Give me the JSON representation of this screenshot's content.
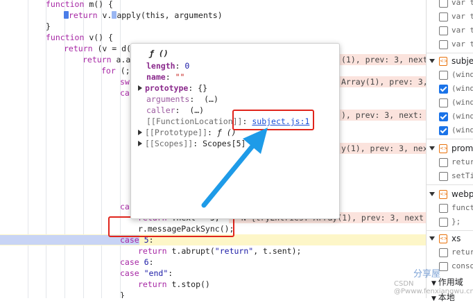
{
  "code": {
    "line1": {
      "kw": "function",
      "rest": " m() {"
    },
    "line2": {
      "kw": "return",
      "a": " v.",
      "b": "apply(this, arguments)"
    },
    "line3": "}",
    "line4": {
      "kw": "function",
      "rest": " v() {"
    },
    "line5": {
      "kw": "return",
      "rest": " (v = d(a"
    },
    "line6": {
      "kw": "return",
      "rest": " a.a"
    },
    "line7": {
      "kw": "for",
      "rest": " (;"
    },
    "line8": "swi",
    "line9": "cas",
    "line10": "cas",
    "line11": {
      "a": "return ",
      "b": ".next = 5;"
    },
    "line12": "r.messagePackSync();",
    "line13": {
      "kw": "case",
      "num": " 5",
      "rest": ":"
    },
    "line14": {
      "kw": "return",
      "a": " t.abrupt(",
      "str": "\"return\"",
      "b": ", t.sent);"
    },
    "line15": {
      "kw": "case",
      "num": " 6",
      "rest": ":"
    },
    "line16": {
      "kw": "case",
      "str": " \"end\"",
      "rest": ":"
    },
    "line17": {
      "kw": "return",
      "rest": " t.stop()"
    },
    "line18": "}"
  },
  "inline_values": {
    "v1": "(1), prev: 3, next:",
    "v2": "Array(1), prev: 3,",
    "v3": "), prev: 3, next: 5",
    "v4": "y(1), prev: 3, next",
    "v5": "= N {tryEntries: Array(1), prev: 3, next"
  },
  "popup": {
    "title": "ƒ ()",
    "length_key": "length",
    "length_val": "0",
    "name_key": "name",
    "name_val": "\"\"",
    "prototype_key": "prototype",
    "prototype_val": "{}",
    "arguments_key": "arguments",
    "arguments_val": "(…)",
    "caller_key": "caller",
    "caller_val": "(…)",
    "location_key": "[[FunctionLocation]]",
    "location_val": "subject.js:1",
    "proto_key": "[[Prototype]]",
    "proto_val": "ƒ ()",
    "scopes_key": "[[Scopes]]",
    "scopes_val": "Scopes[5]"
  },
  "right_panel": {
    "rows": [
      {
        "text": "var t",
        "checked": false
      },
      {
        "text": "var t",
        "checked": false
      },
      {
        "text": "var t",
        "checked": false
      },
      {
        "text": "var t",
        "checked": false
      }
    ],
    "group1": "subje",
    "group1_rows": [
      {
        "text": "(wind",
        "checked": false
      },
      {
        "text": "(wind",
        "checked": true
      },
      {
        "text": "(wind",
        "checked": false
      },
      {
        "text": "(wind",
        "checked": true
      },
      {
        "text": "(wind",
        "checked": true
      }
    ],
    "group2": "promi",
    "group2_rows": [
      {
        "text": "retur",
        "checked": false
      },
      {
        "text": "setTi",
        "checked": false
      }
    ],
    "group3": "webp",
    "group3_rows": [
      {
        "text": "funct",
        "checked": false
      },
      {
        "text": "};",
        "checked": false
      }
    ],
    "group4": "xs",
    "group4_rows": [
      {
        "text": "retur",
        "checked": false
      },
      {
        "text": "conso",
        "checked": false
      }
    ],
    "section_scope": "作用域",
    "section_local": "本地"
  },
  "watermark": {
    "top": "分享屋",
    "bottom": "CSDN @Pwww.fenxiangwu.cn"
  },
  "colors": {
    "highlight": "#e0241b",
    "arrow": "#1e9be8",
    "paused_line": "#fdf6c8"
  }
}
